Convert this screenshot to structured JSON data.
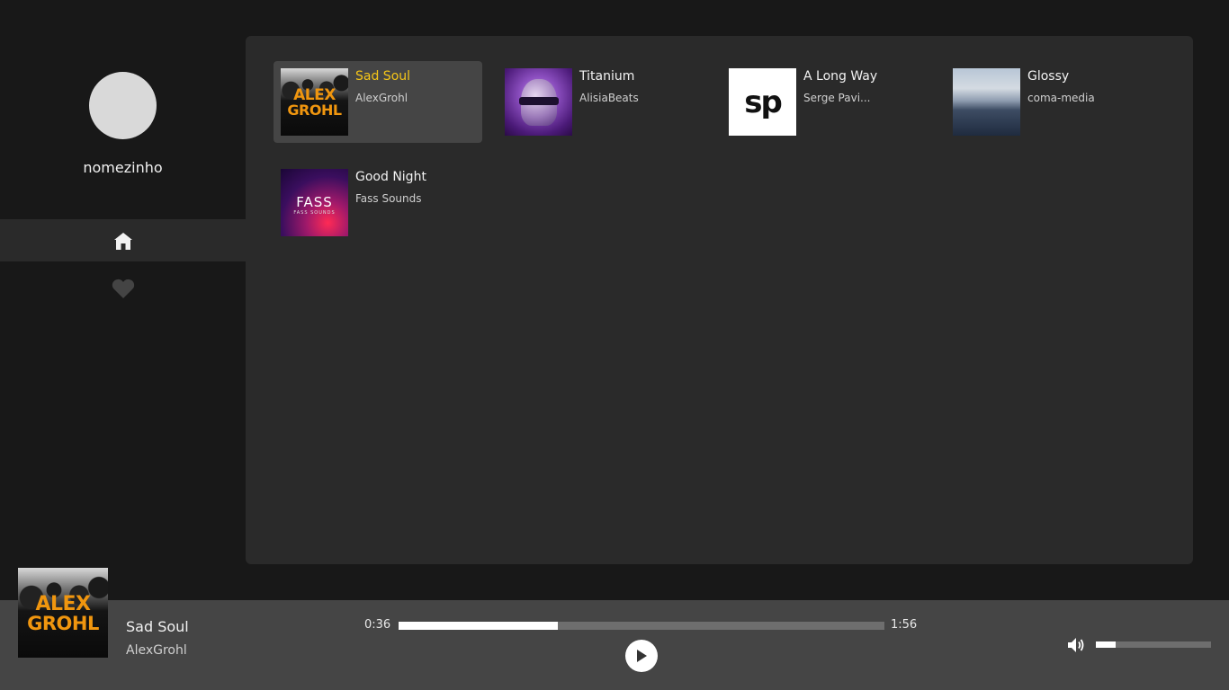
{
  "user": {
    "name": "nomezinho"
  },
  "nav": [
    {
      "id": "home",
      "icon": "home-icon",
      "active": true
    },
    {
      "id": "favorites",
      "icon": "heart-icon",
      "active": false
    }
  ],
  "tracks": [
    {
      "title": "Sad Soul",
      "artist": "AlexGrohl",
      "cover": "alex-grohl-cover",
      "selected": true
    },
    {
      "title": "Titanium",
      "artist": "AlisiaBeats",
      "cover": "titanium-cover",
      "selected": false
    },
    {
      "title": "A Long Way",
      "artist": "Serge Pavi...",
      "cover": "sp-cover",
      "selected": false
    },
    {
      "title": "Glossy",
      "artist": "coma-media",
      "cover": "glossy-cover",
      "selected": false
    },
    {
      "title": "Good Night",
      "artist": "Fass Sounds",
      "cover": "fass-cover",
      "selected": false
    }
  ],
  "covers": {
    "alex": [
      "ALEX",
      "GROHL"
    ],
    "sp": "sp",
    "fass": {
      "logo": "FASS",
      "sub": "FASS SOUNDS"
    }
  },
  "player": {
    "title": "Sad Soul",
    "artist": "AlexGrohl",
    "current_time": "0:36",
    "duration": "1:56",
    "progress": 0.327,
    "volume": 0.17,
    "play_icon": "play-icon",
    "volume_icon": "volume-icon"
  },
  "colors": {
    "accent": "#f5c518",
    "background": "#181818",
    "panel": "#2a2a2a",
    "player_bar": "#454545"
  }
}
